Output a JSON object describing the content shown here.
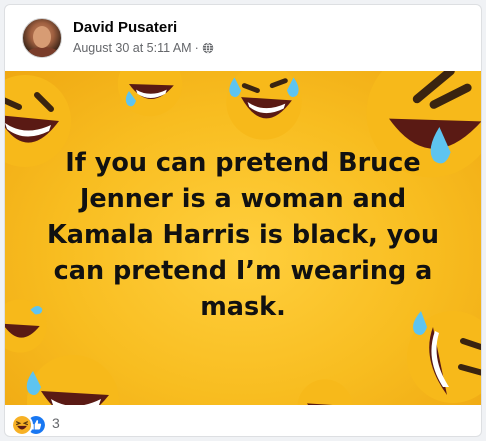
{
  "post": {
    "author": "David Pusateri",
    "timestamp": "August 30 at 5:11 AM",
    "separator": "·",
    "privacy_icon": "globe-icon"
  },
  "image": {
    "lines": [
      "If you can pretend Bruce",
      "Jenner is a woman and",
      "Kamala Harris is black, you",
      "can pretend I’m wearing a",
      "mask."
    ],
    "background_color": "#f8bd20"
  },
  "reactions": {
    "icons": [
      "haha-reaction-icon",
      "like-reaction-icon"
    ],
    "count": "3"
  }
}
